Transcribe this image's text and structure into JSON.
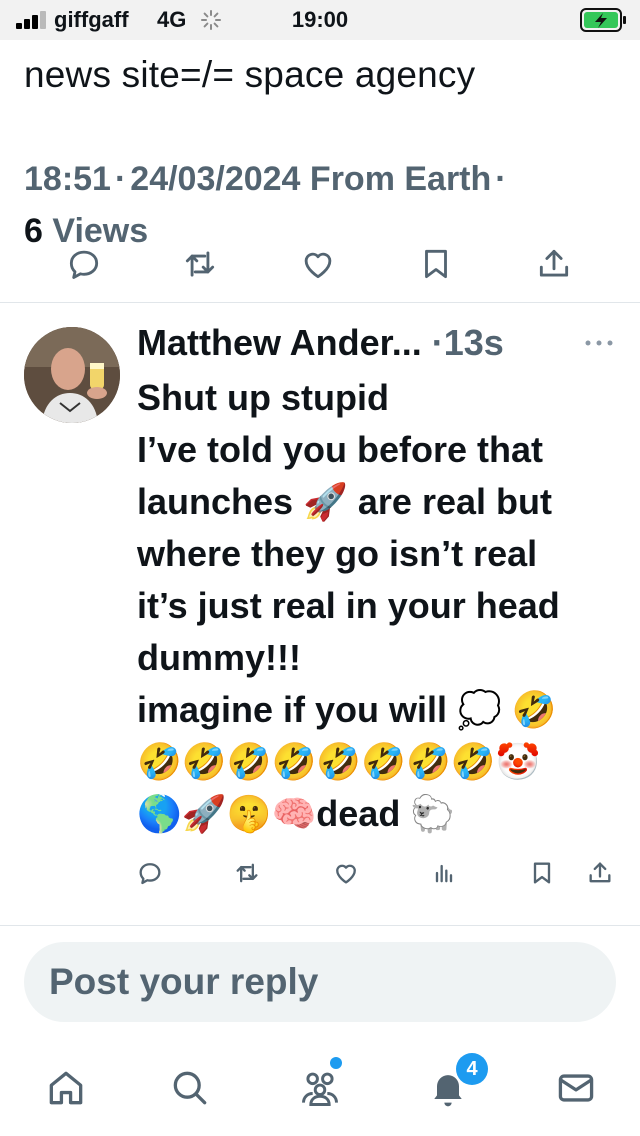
{
  "status_bar": {
    "carrier": "giffgaff",
    "network": "4G",
    "time": "19:00"
  },
  "post": {
    "text": "news site=/= space agency",
    "time": "18:51",
    "date": "24/03/2024",
    "source": "From Earth",
    "views_count": "6",
    "views_label": "Views"
  },
  "reply": {
    "author": "Matthew Ander...",
    "separator": "·",
    "age": "13s",
    "lines": [
      "Shut up stupid",
      "I’ve told you before that",
      "launches 🚀 are real but",
      "where they go isn’t real",
      "it’s just real in your head",
      "dummy!!!",
      "imagine if you will 💭 🤣",
      "🤣🤣🤣🤣🤣🤣🤣🤣🤡",
      "🌎🚀🤫🧠dead 🐑"
    ]
  },
  "composer": {
    "placeholder": "Post your reply"
  },
  "tabbar": {
    "notifications_count": "4"
  },
  "colors": {
    "accent": "#1d9bf0",
    "secondary_text": "#536471",
    "primary_text": "#0f1419",
    "composer_bg": "#eff3f4",
    "battery_green": "#34c759"
  },
  "icons": {
    "post_actions": [
      "reply-icon",
      "repost-icon",
      "like-icon",
      "bookmark-icon",
      "share-icon"
    ],
    "reply_actions": [
      "reply-icon",
      "repost-icon",
      "like-icon",
      "analytics-icon",
      "bookmark-icon",
      "share-icon"
    ],
    "tabs": [
      "home-icon",
      "search-icon",
      "communities-icon",
      "notifications-icon",
      "messages-icon"
    ]
  }
}
